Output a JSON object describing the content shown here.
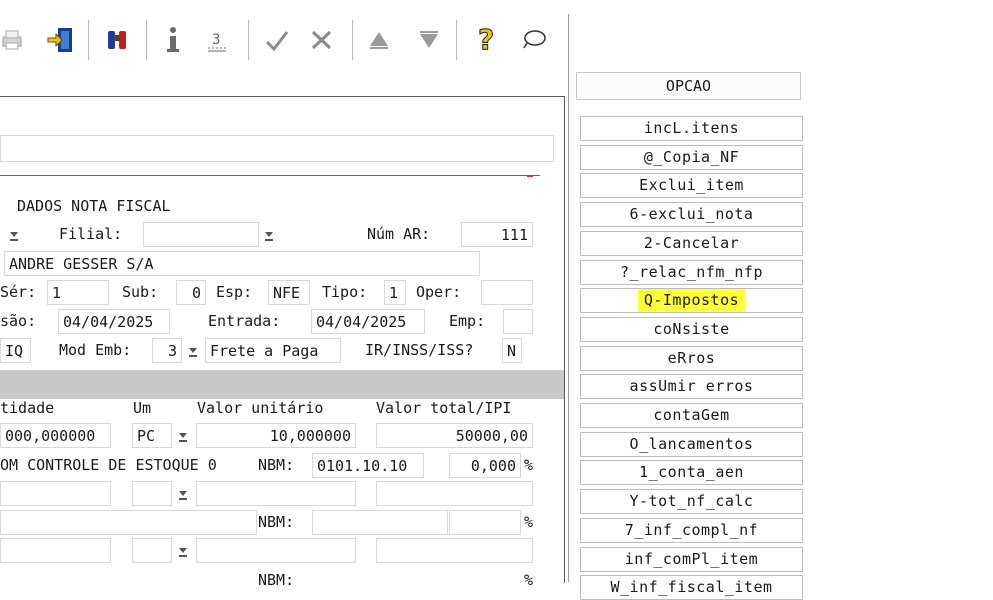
{
  "options": {
    "header": "OPCAO",
    "buttons": [
      "incL.itens",
      "@_Copia_NF",
      "Exclui_item",
      "6-exclui_nota",
      "2-Cancelar",
      "?_relac_nfm_nfp",
      "Q-Impostos",
      "coNsiste",
      "eRros",
      "assUmir erros",
      "contaGem",
      "O_lancamentos",
      "1_conta_aen",
      "Y-tot_nf_calc",
      "7_inf_compl_nf",
      "inf_comPl_item",
      "W_inf_fiscal_item"
    ],
    "highlighted": "Q-Impostos",
    "highlight_color": "#ffff33"
  },
  "form": {
    "section_title": "DADOS NOTA FISCAL",
    "filial_label": "Filial:",
    "filial_value": "",
    "num_ar_label": "Núm AR:",
    "num_ar_value": "111",
    "supplier_name": "ANDRE GESSER S/A",
    "ser_label": "Sér:",
    "ser_value": "1",
    "sub_label": "Sub:",
    "sub_value": "0",
    "esp_label": "Esp:",
    "esp_value": "NFE",
    "tipo_label": "Tipo:",
    "tipo_value": "1",
    "oper_label": "Oper:",
    "oper_value": "",
    "emissao_label": "são:",
    "emissao_value": "04/04/2025",
    "entrada_label": "Entrada:",
    "entrada_value": "04/04/2025",
    "emp_label": "Emp:",
    "emp_value": "",
    "frete_left": "IQ",
    "mod_emb_label": "Mod Emb:",
    "mod_emb_value": "3",
    "frete_value": "Frete a Paga",
    "ir_label": "IR/INSS/ISS?",
    "ir_value": "N"
  },
  "items": {
    "headers": [
      "tidade",
      "Um",
      "Valor unitário",
      "Valor total/IPI"
    ],
    "row1": {
      "quantidade": "000,000000",
      "um": "PC",
      "valor_unitario": "10,000000",
      "valor_total": "50000,00",
      "description": "OM CONTROLE DE ESTOQUE 0",
      "nbm_label": "NBM:",
      "nbm_value": "0101.10.10",
      "ipi": "0,000",
      "pct": "%"
    },
    "row2": {
      "nbm_label": "NBM:",
      "pct": "%"
    },
    "row3": {
      "nbm_label": "NBM:",
      "pct": "%"
    }
  },
  "colors": {
    "accent_line": "#e03030",
    "gray_band": "#c8c8c8"
  },
  "toolbar_icons": [
    "printer-icon",
    "exit-door-icon",
    "binoculars-icon",
    "info-icon",
    "counter-icon",
    "confirm-check-icon",
    "cancel-icon",
    "previous-triangle-icon",
    "next-triangle-icon",
    "help-question-icon",
    "chat-bubble-icon"
  ]
}
